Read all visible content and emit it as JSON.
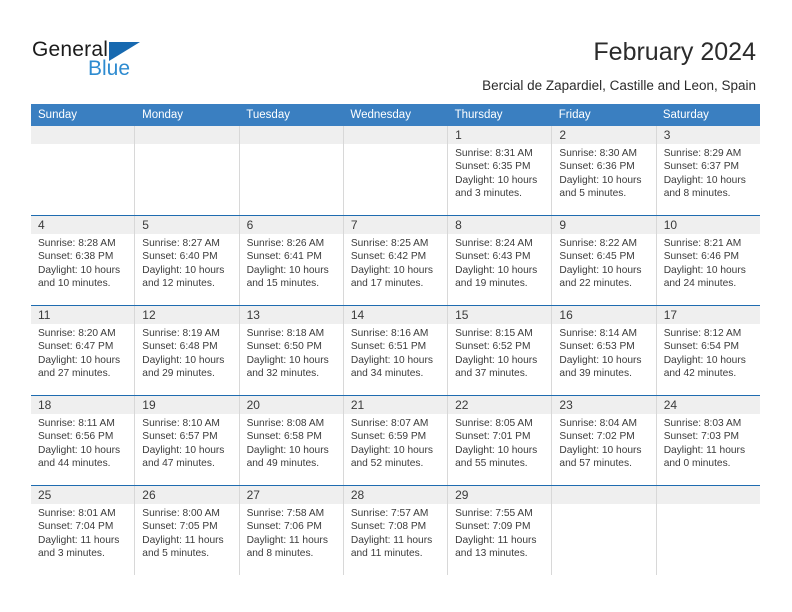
{
  "brand": {
    "line1": "General",
    "line2": "Blue",
    "triangle_color": "#1769b0",
    "blue_color": "#2e8bd0"
  },
  "header": {
    "title": "February 2024",
    "subtitle": "Bercial de Zapardiel, Castille and Leon, Spain"
  },
  "theme": {
    "header_row_bg": "#3a7fc1",
    "week_divider": "#1f6cb0",
    "daynum_bg": "#efefef",
    "cell_border": "#d8d8d8",
    "text": "#3b3b3b"
  },
  "calendar": {
    "weekday_headers": [
      "Sunday",
      "Monday",
      "Tuesday",
      "Wednesday",
      "Thursday",
      "Friday",
      "Saturday"
    ],
    "weeks": [
      [
        {
          "day": "",
          "empty": true
        },
        {
          "day": "",
          "empty": true
        },
        {
          "day": "",
          "empty": true
        },
        {
          "day": "",
          "empty": true
        },
        {
          "day": "1",
          "sunrise": "Sunrise: 8:31 AM",
          "sunset": "Sunset: 6:35 PM",
          "daylight": "Daylight: 10 hours and 3 minutes."
        },
        {
          "day": "2",
          "sunrise": "Sunrise: 8:30 AM",
          "sunset": "Sunset: 6:36 PM",
          "daylight": "Daylight: 10 hours and 5 minutes."
        },
        {
          "day": "3",
          "sunrise": "Sunrise: 8:29 AM",
          "sunset": "Sunset: 6:37 PM",
          "daylight": "Daylight: 10 hours and 8 minutes."
        }
      ],
      [
        {
          "day": "4",
          "sunrise": "Sunrise: 8:28 AM",
          "sunset": "Sunset: 6:38 PM",
          "daylight": "Daylight: 10 hours and 10 minutes."
        },
        {
          "day": "5",
          "sunrise": "Sunrise: 8:27 AM",
          "sunset": "Sunset: 6:40 PM",
          "daylight": "Daylight: 10 hours and 12 minutes."
        },
        {
          "day": "6",
          "sunrise": "Sunrise: 8:26 AM",
          "sunset": "Sunset: 6:41 PM",
          "daylight": "Daylight: 10 hours and 15 minutes."
        },
        {
          "day": "7",
          "sunrise": "Sunrise: 8:25 AM",
          "sunset": "Sunset: 6:42 PM",
          "daylight": "Daylight: 10 hours and 17 minutes."
        },
        {
          "day": "8",
          "sunrise": "Sunrise: 8:24 AM",
          "sunset": "Sunset: 6:43 PM",
          "daylight": "Daylight: 10 hours and 19 minutes."
        },
        {
          "day": "9",
          "sunrise": "Sunrise: 8:22 AM",
          "sunset": "Sunset: 6:45 PM",
          "daylight": "Daylight: 10 hours and 22 minutes."
        },
        {
          "day": "10",
          "sunrise": "Sunrise: 8:21 AM",
          "sunset": "Sunset: 6:46 PM",
          "daylight": "Daylight: 10 hours and 24 minutes."
        }
      ],
      [
        {
          "day": "11",
          "sunrise": "Sunrise: 8:20 AM",
          "sunset": "Sunset: 6:47 PM",
          "daylight": "Daylight: 10 hours and 27 minutes."
        },
        {
          "day": "12",
          "sunrise": "Sunrise: 8:19 AM",
          "sunset": "Sunset: 6:48 PM",
          "daylight": "Daylight: 10 hours and 29 minutes."
        },
        {
          "day": "13",
          "sunrise": "Sunrise: 8:18 AM",
          "sunset": "Sunset: 6:50 PM",
          "daylight": "Daylight: 10 hours and 32 minutes."
        },
        {
          "day": "14",
          "sunrise": "Sunrise: 8:16 AM",
          "sunset": "Sunset: 6:51 PM",
          "daylight": "Daylight: 10 hours and 34 minutes."
        },
        {
          "day": "15",
          "sunrise": "Sunrise: 8:15 AM",
          "sunset": "Sunset: 6:52 PM",
          "daylight": "Daylight: 10 hours and 37 minutes."
        },
        {
          "day": "16",
          "sunrise": "Sunrise: 8:14 AM",
          "sunset": "Sunset: 6:53 PM",
          "daylight": "Daylight: 10 hours and 39 minutes."
        },
        {
          "day": "17",
          "sunrise": "Sunrise: 8:12 AM",
          "sunset": "Sunset: 6:54 PM",
          "daylight": "Daylight: 10 hours and 42 minutes."
        }
      ],
      [
        {
          "day": "18",
          "sunrise": "Sunrise: 8:11 AM",
          "sunset": "Sunset: 6:56 PM",
          "daylight": "Daylight: 10 hours and 44 minutes."
        },
        {
          "day": "19",
          "sunrise": "Sunrise: 8:10 AM",
          "sunset": "Sunset: 6:57 PM",
          "daylight": "Daylight: 10 hours and 47 minutes."
        },
        {
          "day": "20",
          "sunrise": "Sunrise: 8:08 AM",
          "sunset": "Sunset: 6:58 PM",
          "daylight": "Daylight: 10 hours and 49 minutes."
        },
        {
          "day": "21",
          "sunrise": "Sunrise: 8:07 AM",
          "sunset": "Sunset: 6:59 PM",
          "daylight": "Daylight: 10 hours and 52 minutes."
        },
        {
          "day": "22",
          "sunrise": "Sunrise: 8:05 AM",
          "sunset": "Sunset: 7:01 PM",
          "daylight": "Daylight: 10 hours and 55 minutes."
        },
        {
          "day": "23",
          "sunrise": "Sunrise: 8:04 AM",
          "sunset": "Sunset: 7:02 PM",
          "daylight": "Daylight: 10 hours and 57 minutes."
        },
        {
          "day": "24",
          "sunrise": "Sunrise: 8:03 AM",
          "sunset": "Sunset: 7:03 PM",
          "daylight": "Daylight: 11 hours and 0 minutes."
        }
      ],
      [
        {
          "day": "25",
          "sunrise": "Sunrise: 8:01 AM",
          "sunset": "Sunset: 7:04 PM",
          "daylight": "Daylight: 11 hours and 3 minutes."
        },
        {
          "day": "26",
          "sunrise": "Sunrise: 8:00 AM",
          "sunset": "Sunset: 7:05 PM",
          "daylight": "Daylight: 11 hours and 5 minutes."
        },
        {
          "day": "27",
          "sunrise": "Sunrise: 7:58 AM",
          "sunset": "Sunset: 7:06 PM",
          "daylight": "Daylight: 11 hours and 8 minutes."
        },
        {
          "day": "28",
          "sunrise": "Sunrise: 7:57 AM",
          "sunset": "Sunset: 7:08 PM",
          "daylight": "Daylight: 11 hours and 11 minutes."
        },
        {
          "day": "29",
          "sunrise": "Sunrise: 7:55 AM",
          "sunset": "Sunset: 7:09 PM",
          "daylight": "Daylight: 11 hours and 13 minutes."
        },
        {
          "day": "",
          "empty": true
        },
        {
          "day": "",
          "empty": true
        }
      ]
    ]
  }
}
